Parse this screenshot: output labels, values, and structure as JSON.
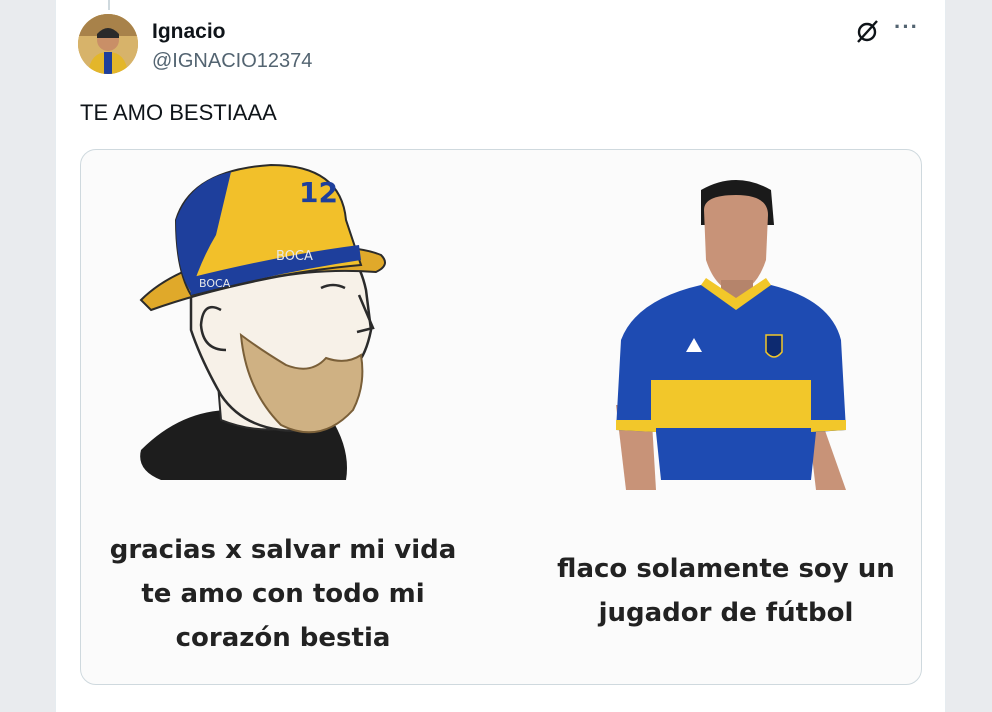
{
  "tweet": {
    "user_name": "Ignacio",
    "handle": "@IGNACIO12374",
    "text": "TE AMO BESTIAAA",
    "more_icon": "more-horizontal-icon",
    "grok_icon": "grok-icon"
  },
  "meme": {
    "left_caption": "gracias x salvar mi vida te amo con todo mi corazón bestia",
    "right_caption": "flaco solamente soy un jugador de fútbol",
    "hat_number": "12",
    "hat_text_1": "BOCA",
    "hat_text_2": "BOCA",
    "colors": {
      "boca_blue": "#1e3f9c",
      "boca_gold": "#f2c02a"
    }
  }
}
